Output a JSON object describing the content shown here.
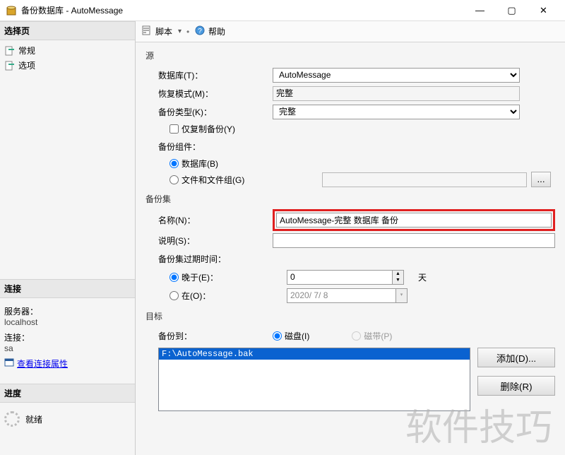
{
  "window": {
    "title": "备份数据库 - AutoMessage",
    "min": "—",
    "max": "▢",
    "close": "✕"
  },
  "sidebar": {
    "pages_header": "选择页",
    "pages": [
      {
        "label": "常规"
      },
      {
        "label": "选项"
      }
    ],
    "conn_header": "连接",
    "server_label": "服务器：",
    "server_value": "localhost",
    "conn_label": "连接：",
    "conn_value": "sa",
    "view_props": "查看连接属性",
    "progress_header": "进度",
    "progress_status": "就绪"
  },
  "toolbar": {
    "script": "脚本",
    "help": "帮助"
  },
  "source": {
    "group": "源",
    "database_label": "数据库(T)：",
    "database_value": "AutoMessage",
    "recovery_label": "恢复模式(M)：",
    "recovery_value": "完整",
    "backup_type_label": "备份类型(K)：",
    "backup_type_value": "完整",
    "copy_only": "仅复制备份(Y)",
    "component_label": "备份组件：",
    "component_db": "数据库(B)",
    "component_files": "文件和文件组(G)",
    "ellipsis": "..."
  },
  "set": {
    "group": "备份集",
    "name_label": "名称(N)：",
    "name_value": "AutoMessage-完整 数据库 备份",
    "desc_label": "说明(S)：",
    "desc_value": "",
    "expire_label": "备份集过期时间：",
    "after_label": "晚于(E)：",
    "after_value": "0",
    "after_unit": "天",
    "on_label": "在(O)：",
    "on_value": "2020/ 7/ 8"
  },
  "dest": {
    "group": "目标",
    "to_label": "备份到：",
    "disk": "磁盘(I)",
    "tape": "磁带(P)",
    "items": [
      "F:\\AutoMessage.bak"
    ],
    "add": "添加(D)...",
    "remove": "删除(R)"
  },
  "watermark": "软件技巧"
}
